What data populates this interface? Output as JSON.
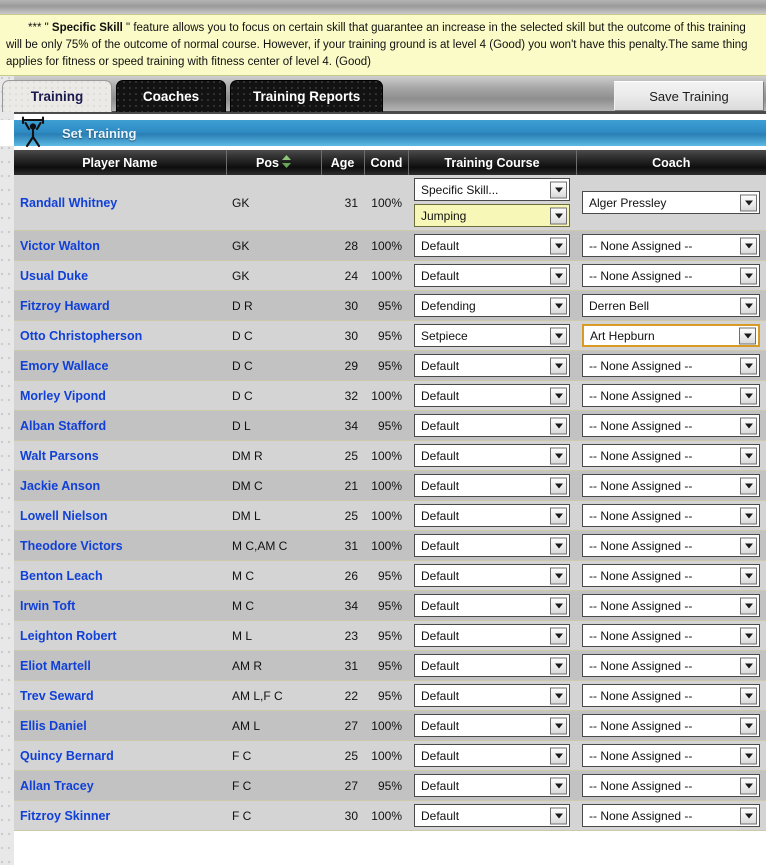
{
  "notice": {
    "text_part1": "*** \" ",
    "bold": "Specific Skill",
    "text_part2": " \" feature allows you to focus on certain skill that guarantee an increase in the selected skill but the outcome of this training will be only 75% of the outcome of normal course. However, if your training ground is at level 4 (Good) you won't have this penalty.The same thing applies for fitness or speed training with fitness center of level 4. (Good)"
  },
  "tabs": [
    {
      "label": "Training",
      "active": true
    },
    {
      "label": "Coaches",
      "active": false
    },
    {
      "label": "Training Reports",
      "active": false
    }
  ],
  "save_button": {
    "label": "Save Training"
  },
  "section": {
    "title": "Set Training",
    "icon": "weightlifter-icon",
    "accent": "#2f8cc4"
  },
  "table": {
    "columns": [
      "Player Name",
      "Pos",
      "Age",
      "Cond",
      "Training Course",
      "Coach"
    ],
    "sort_column": "Pos",
    "sort_indicator": "both-arrows",
    "sort_color": "#7fbf6a",
    "default_course": "Default",
    "default_coach": "-- None Assigned --",
    "rows": [
      {
        "name": "Randall Whitney",
        "pos": "GK",
        "age": "31",
        "cond": "100%",
        "course": "Specific Skill...",
        "subcourse": "Jumping",
        "coach": "Alger Pressley",
        "course_highlight": false,
        "subcourse_highlight": true,
        "coach_focus": false
      },
      {
        "name": "Victor Walton",
        "pos": "GK",
        "age": "28",
        "cond": "100%",
        "course": "Default",
        "subcourse": null,
        "coach": "-- None Assigned --",
        "course_highlight": false,
        "subcourse_highlight": false,
        "coach_focus": false
      },
      {
        "name": "Usual Duke",
        "pos": "GK",
        "age": "24",
        "cond": "100%",
        "course": "Default",
        "subcourse": null,
        "coach": "-- None Assigned --",
        "course_highlight": false,
        "subcourse_highlight": false,
        "coach_focus": false
      },
      {
        "name": "Fitzroy Haward",
        "pos": "D R",
        "age": "30",
        "cond": "95%",
        "course": "Defending",
        "subcourse": null,
        "coach": "Derren Bell",
        "course_highlight": false,
        "subcourse_highlight": false,
        "coach_focus": false
      },
      {
        "name": "Otto Christopherson",
        "pos": "D C",
        "age": "30",
        "cond": "95%",
        "course": "Setpiece",
        "subcourse": null,
        "coach": "Art Hepburn",
        "course_highlight": false,
        "subcourse_highlight": false,
        "coach_focus": true
      },
      {
        "name": "Emory Wallace",
        "pos": "D C",
        "age": "29",
        "cond": "95%",
        "course": "Default",
        "subcourse": null,
        "coach": "-- None Assigned --",
        "course_highlight": false,
        "subcourse_highlight": false,
        "coach_focus": false
      },
      {
        "name": "Morley Vipond",
        "pos": "D C",
        "age": "32",
        "cond": "100%",
        "course": "Default",
        "subcourse": null,
        "coach": "-- None Assigned --",
        "course_highlight": false,
        "subcourse_highlight": false,
        "coach_focus": false
      },
      {
        "name": "Alban Stafford",
        "pos": "D L",
        "age": "34",
        "cond": "95%",
        "course": "Default",
        "subcourse": null,
        "coach": "-- None Assigned --",
        "course_highlight": false,
        "subcourse_highlight": false,
        "coach_focus": false
      },
      {
        "name": "Walt Parsons",
        "pos": "DM R",
        "age": "25",
        "cond": "100%",
        "course": "Default",
        "subcourse": null,
        "coach": "-- None Assigned --",
        "course_highlight": false,
        "subcourse_highlight": false,
        "coach_focus": false
      },
      {
        "name": "Jackie Anson",
        "pos": "DM C",
        "age": "21",
        "cond": "100%",
        "course": "Default",
        "subcourse": null,
        "coach": "-- None Assigned --",
        "course_highlight": false,
        "subcourse_highlight": false,
        "coach_focus": false
      },
      {
        "name": "Lowell Nielson",
        "pos": "DM L",
        "age": "25",
        "cond": "100%",
        "course": "Default",
        "subcourse": null,
        "coach": "-- None Assigned --",
        "course_highlight": false,
        "subcourse_highlight": false,
        "coach_focus": false
      },
      {
        "name": "Theodore Victors",
        "pos": "M C,AM C",
        "age": "31",
        "cond": "100%",
        "course": "Default",
        "subcourse": null,
        "coach": "-- None Assigned --",
        "course_highlight": false,
        "subcourse_highlight": false,
        "coach_focus": false
      },
      {
        "name": "Benton Leach",
        "pos": "M C",
        "age": "26",
        "cond": "95%",
        "course": "Default",
        "subcourse": null,
        "coach": "-- None Assigned --",
        "course_highlight": false,
        "subcourse_highlight": false,
        "coach_focus": false
      },
      {
        "name": "Irwin Toft",
        "pos": "M C",
        "age": "34",
        "cond": "95%",
        "course": "Default",
        "subcourse": null,
        "coach": "-- None Assigned --",
        "course_highlight": false,
        "subcourse_highlight": false,
        "coach_focus": false
      },
      {
        "name": "Leighton Robert",
        "pos": "M L",
        "age": "23",
        "cond": "95%",
        "course": "Default",
        "subcourse": null,
        "coach": "-- None Assigned --",
        "course_highlight": false,
        "subcourse_highlight": false,
        "coach_focus": false
      },
      {
        "name": "Eliot Martell",
        "pos": "AM R",
        "age": "31",
        "cond": "95%",
        "course": "Default",
        "subcourse": null,
        "coach": "-- None Assigned --",
        "course_highlight": false,
        "subcourse_highlight": false,
        "coach_focus": false
      },
      {
        "name": "Trev Seward",
        "pos": "AM L,F C",
        "age": "22",
        "cond": "95%",
        "course": "Default",
        "subcourse": null,
        "coach": "-- None Assigned --",
        "course_highlight": false,
        "subcourse_highlight": false,
        "coach_focus": false
      },
      {
        "name": "Ellis Daniel",
        "pos": "AM L",
        "age": "27",
        "cond": "100%",
        "course": "Default",
        "subcourse": null,
        "coach": "-- None Assigned --",
        "course_highlight": false,
        "subcourse_highlight": false,
        "coach_focus": false
      },
      {
        "name": "Quincy Bernard",
        "pos": "F C",
        "age": "25",
        "cond": "100%",
        "course": "Default",
        "subcourse": null,
        "coach": "-- None Assigned --",
        "course_highlight": false,
        "subcourse_highlight": false,
        "coach_focus": false
      },
      {
        "name": "Allan Tracey",
        "pos": "F C",
        "age": "27",
        "cond": "95%",
        "course": "Default",
        "subcourse": null,
        "coach": "-- None Assigned --",
        "course_highlight": false,
        "subcourse_highlight": false,
        "coach_focus": false
      },
      {
        "name": "Fitzroy Skinner",
        "pos": "F C",
        "age": "30",
        "cond": "100%",
        "course": "Default",
        "subcourse": null,
        "coach": "-- None Assigned --",
        "course_highlight": false,
        "subcourse_highlight": false,
        "coach_focus": false
      }
    ]
  }
}
